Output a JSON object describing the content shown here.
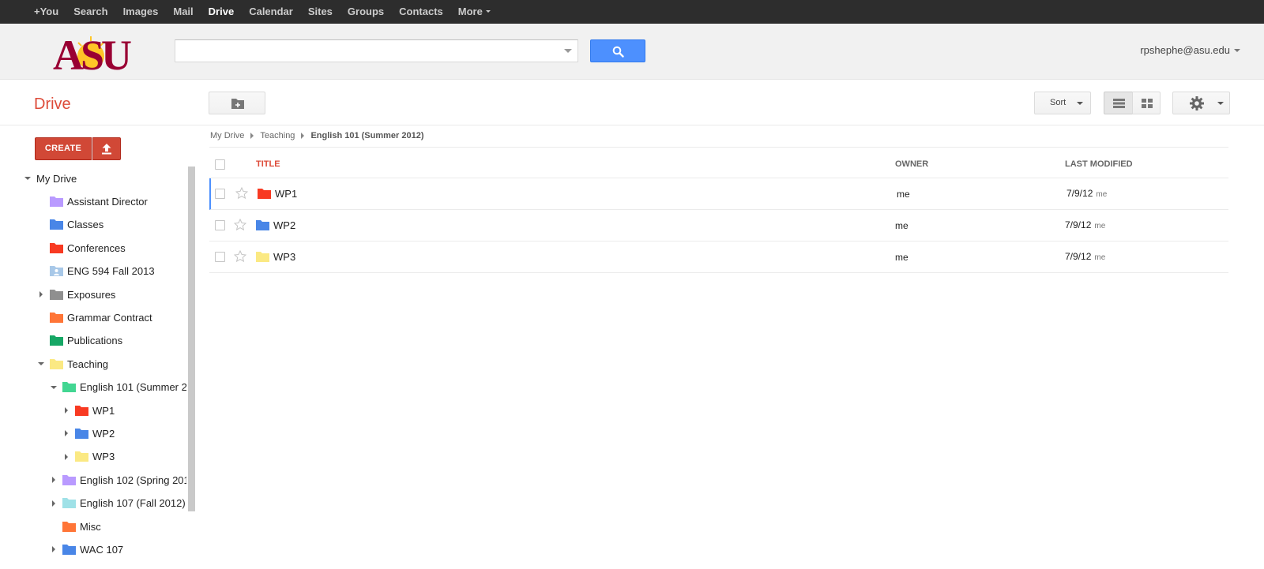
{
  "topnav": [
    "+You",
    "Search",
    "Images",
    "Mail",
    "Drive",
    "Calendar",
    "Sites",
    "Groups",
    "Contacts",
    "More"
  ],
  "topnav_active": "Drive",
  "logo_text": "ASU",
  "search": {
    "value": "",
    "placeholder": ""
  },
  "account": "rpshephe@asu.edu",
  "app_title": "Drive",
  "toolbar": {
    "sort_label": "Sort"
  },
  "create_label": "CREATE",
  "tree": [
    {
      "label": "My Drive",
      "level": 0,
      "toggle": "open",
      "color": ""
    },
    {
      "label": "Assistant Director",
      "level": 1,
      "toggle": "",
      "color": "#b99aff"
    },
    {
      "label": "Classes",
      "level": 1,
      "toggle": "",
      "color": "#4986e7"
    },
    {
      "label": "Conferences",
      "level": 1,
      "toggle": "",
      "color": "#f83a22"
    },
    {
      "label": "ENG 594 Fall 2013",
      "level": 1,
      "toggle": "",
      "color": "#a8c8e8",
      "shared": true
    },
    {
      "label": "Exposures",
      "level": 1,
      "toggle": "closed",
      "color": "#8f8f8f"
    },
    {
      "label": "Grammar Contract",
      "level": 1,
      "toggle": "",
      "color": "#ff7537"
    },
    {
      "label": "Publications",
      "level": 1,
      "toggle": "",
      "color": "#16a765"
    },
    {
      "label": "Teaching",
      "level": 1,
      "toggle": "open",
      "color": "#fbe983"
    },
    {
      "label": "English 101 (Summer 2",
      "level": 2,
      "toggle": "open",
      "color": "#42d692"
    },
    {
      "label": "WP1",
      "level": 3,
      "toggle": "closed",
      "color": "#f83a22"
    },
    {
      "label": "WP2",
      "level": 3,
      "toggle": "closed",
      "color": "#4986e7"
    },
    {
      "label": "WP3",
      "level": 3,
      "toggle": "closed",
      "color": "#fbe983"
    },
    {
      "label": "English 102 (Spring 201",
      "level": 2,
      "toggle": "closed",
      "color": "#b99aff"
    },
    {
      "label": "English 107 (Fall 2012)",
      "level": 2,
      "toggle": "closed",
      "color": "#9fe1e7"
    },
    {
      "label": "Misc",
      "level": 2,
      "toggle": "",
      "color": "#ff7537"
    },
    {
      "label": "WAC 107",
      "level": 2,
      "toggle": "closed",
      "color": "#4986e7"
    }
  ],
  "breadcrumb": [
    "My Drive",
    "Teaching",
    "English 101 (Summer 2012)"
  ],
  "columns": {
    "title": "TITLE",
    "owner": "OWNER",
    "modified": "LAST MODIFIED"
  },
  "files": [
    {
      "name": "WP1",
      "color": "#f83a22",
      "owner": "me",
      "modified": "7/9/12",
      "modified_by": "me",
      "selected": true
    },
    {
      "name": "WP2",
      "color": "#4986e7",
      "owner": "me",
      "modified": "7/9/12",
      "modified_by": "me",
      "selected": false
    },
    {
      "name": "WP3",
      "color": "#fbe983",
      "owner": "me",
      "modified": "7/9/12",
      "modified_by": "me",
      "selected": false
    }
  ]
}
